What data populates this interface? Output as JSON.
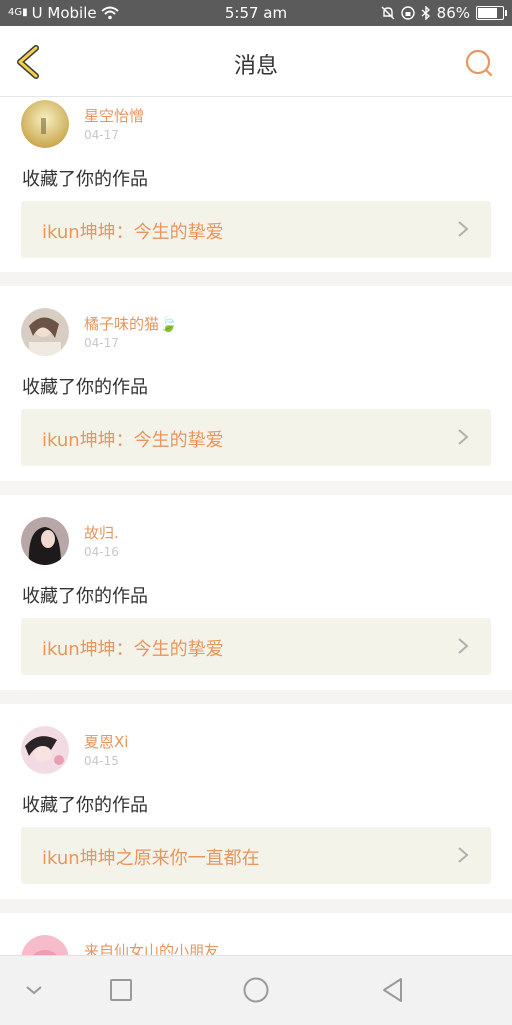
{
  "status_bar": {
    "carrier": "U Mobile",
    "signal_prefix": "4G",
    "time": "5:57 am",
    "battery": "86%",
    "battery_level": 0.86
  },
  "header": {
    "title": "消息",
    "back_icon": "back-chevron-icon",
    "search_icon": "search-icon",
    "accent": "#e8955e"
  },
  "messages": [
    {
      "user": "星空怡憎",
      "date": "04-17",
      "action": "收藏了你的作品",
      "work": "ikun坤坤：今生的挚爱"
    },
    {
      "user": "橘子味的猫🍃",
      "date": "04-17",
      "action": "收藏了你的作品",
      "work": "ikun坤坤：今生的挚爱"
    },
    {
      "user": "故归.",
      "date": "04-16",
      "action": "收藏了你的作品",
      "work": "ikun坤坤：今生的挚爱"
    },
    {
      "user": "夏恩Xi",
      "date": "04-15",
      "action": "收藏了你的作品",
      "work": "ikun坤坤之原来你一直都在"
    },
    {
      "user": "来自仙女山的小朋友"
    }
  ],
  "system_nav": {
    "items": [
      "collapse-icon",
      "recents-icon",
      "home-icon",
      "back-icon"
    ]
  }
}
